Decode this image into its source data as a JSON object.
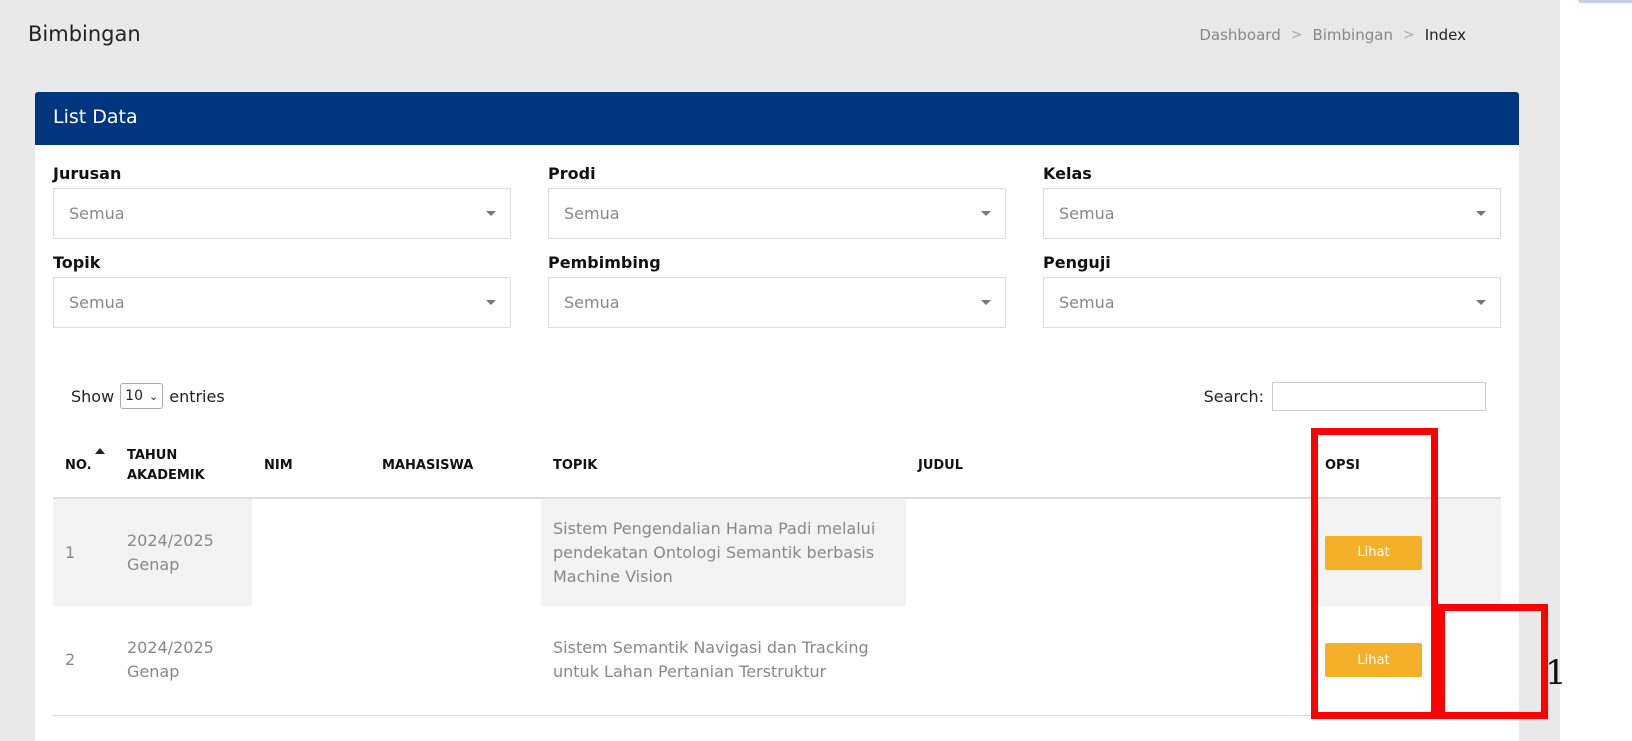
{
  "page": {
    "title": "Bimbingan",
    "breadcrumb": [
      "Dashboard",
      "Bimbingan",
      "Index"
    ],
    "separator": ">"
  },
  "card": {
    "header": "List Data"
  },
  "filters": [
    {
      "label": "Jurusan",
      "value": "Semua"
    },
    {
      "label": "Prodi",
      "value": "Semua"
    },
    {
      "label": "Kelas",
      "value": "Semua"
    },
    {
      "label": "Topik",
      "value": "Semua"
    },
    {
      "label": "Pembimbing",
      "value": "Semua"
    },
    {
      "label": "Penguji",
      "value": "Semua"
    }
  ],
  "table_controls": {
    "show_label": "Show",
    "entries_value": "10",
    "entries_label": "entries",
    "search_label": "Search:"
  },
  "table": {
    "columns": [
      "NO.",
      "TAHUN AKADEMIK",
      "NIM",
      "MAHASISWA",
      "TOPIK",
      "JUDUL",
      "OPSI"
    ],
    "rows": [
      {
        "no": "1",
        "tahun": "2024/2025 Genap",
        "nim": "",
        "mahasiswa": "",
        "topik": "Sistem Pengendalian Hama Padi melalui pendekatan Ontologi Semantik berbasis Machine Vision",
        "judul": "",
        "action": "Lihat"
      },
      {
        "no": "2",
        "tahun": "2024/2025 Genap",
        "nim": "",
        "mahasiswa": "",
        "topik": "Sistem Semantik Navigasi dan Tracking untuk Lahan Pertanian Terstruktur",
        "judul": "",
        "action": "Lihat"
      }
    ]
  },
  "annotation": {
    "label": "1",
    "color": "#ff0000"
  },
  "colors": {
    "header_bg": "#003580",
    "button": "#f5b02a",
    "background": "#e9e9e9"
  }
}
